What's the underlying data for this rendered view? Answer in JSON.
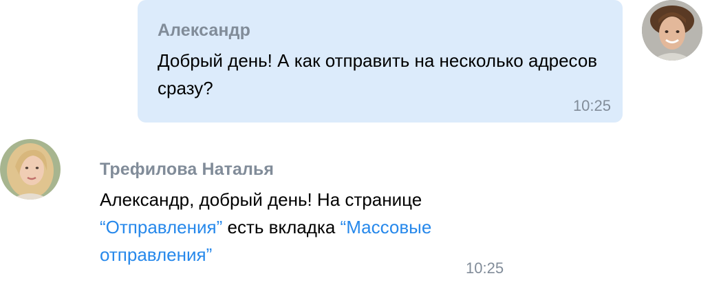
{
  "messages": [
    {
      "direction": "outgoing",
      "sender": "Александр",
      "text": "Добрый день! А как отправить на несколько адресов сразу?",
      "time": "10:25",
      "avatar": "user-avatar-photo"
    },
    {
      "direction": "incoming",
      "sender": "Трефилова Наталья",
      "text_parts": {
        "intro": "Александр, добрый день! На странице ",
        "link1": "“Отправления”",
        "middle": " есть вкладка ",
        "link2": "“Массовые отправления”"
      },
      "time": "10:25",
      "avatar": "agent-avatar-photo"
    }
  ],
  "colors": {
    "outgoing_bubble": "#dcebfb",
    "sender_name": "#818c99",
    "timestamp": "#818c99",
    "link": "#2688eb",
    "text": "#000000"
  }
}
